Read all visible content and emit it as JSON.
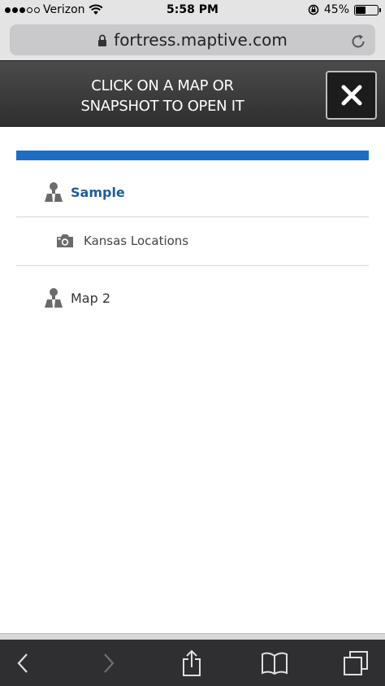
{
  "status": {
    "carrier": "Verizon",
    "time": "5:58 PM",
    "battery_percent": "45%",
    "battery_level": 0.45,
    "signal_bars_filled": 3,
    "signal_bars_total": 5
  },
  "browser": {
    "url": "fortress.maptive.com"
  },
  "header": {
    "message_line1": "CLICK ON A MAP OR",
    "message_line2": "SNAPSHOT TO OPEN IT"
  },
  "items": [
    {
      "label": "Sample",
      "icon": "map-pin-icon",
      "type": "map",
      "active": true
    },
    {
      "label": "Kansas Locations",
      "icon": "camera-icon",
      "type": "snapshot",
      "active": false
    },
    {
      "label": "Map 2",
      "icon": "map-pin-icon",
      "type": "map",
      "active": false
    }
  ],
  "colors": {
    "accent": "#1c6ec4",
    "active_text": "#1c5e9e",
    "header_bg": "#3a3a3a",
    "toolbar_bg": "#2f2f31"
  }
}
